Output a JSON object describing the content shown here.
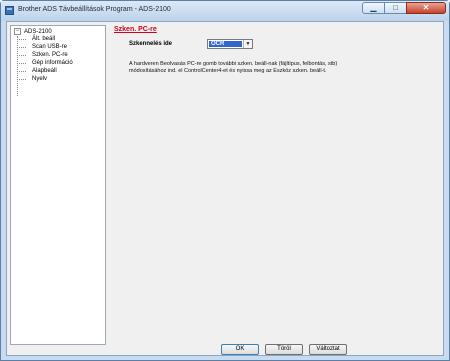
{
  "window": {
    "title": "Brother ADS Távbeállítások Program - ADS-2100",
    "controls": {
      "minimize": "▁",
      "maximize": "□",
      "close": "✕"
    }
  },
  "tree": {
    "root_label": "ADS-2100",
    "expander": "−",
    "items": [
      {
        "label": "Ált. beáll"
      },
      {
        "label": "Scan USB-re"
      },
      {
        "label": "Szken. PC-re"
      },
      {
        "label": "Gép információ"
      },
      {
        "label": "Alapbeáll"
      },
      {
        "label": "Nyelv"
      }
    ]
  },
  "main": {
    "section_title": "Szken. PC-re",
    "scan_to_label": "Szkennelés ide",
    "scan_to_value": "OCR",
    "description": "A hardveren Beolvasás PC-re gomb további szken. beáll-nak (fájltípus, felbontás, stb) módosításához ind. el ControlCenter4-et és nyissa meg az Eszköz szken. beáll-t."
  },
  "buttons": {
    "ok": "OK",
    "delete": "Töröl",
    "change": "Változtat"
  },
  "colors": {
    "section_title": "#d0021b",
    "selected_value_bg": "#3366cc",
    "window_frame": "#c9dcef"
  }
}
